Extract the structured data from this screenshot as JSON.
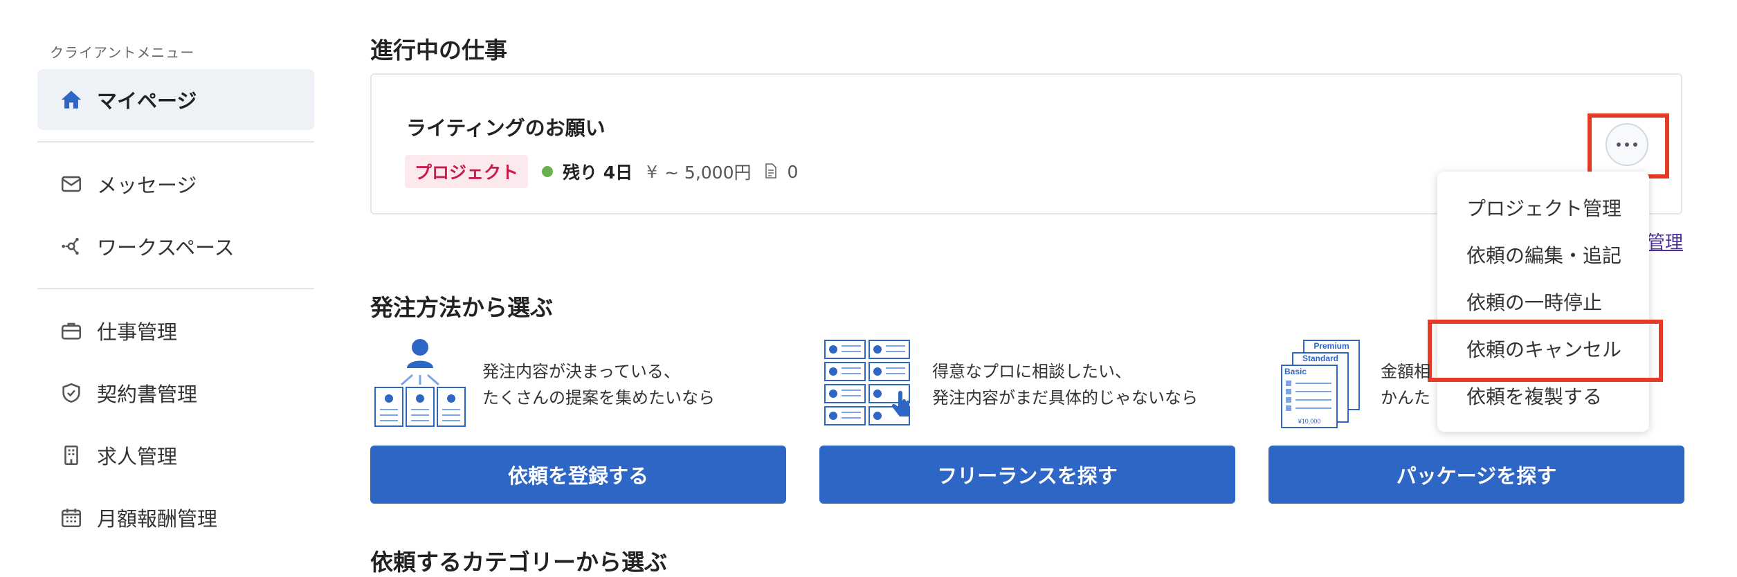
{
  "sidebar": {
    "caption": "クライアントメニュー",
    "items": [
      {
        "label": "マイページ",
        "icon": "home-icon"
      },
      {
        "label": "メッセージ",
        "icon": "mail-icon"
      },
      {
        "label": "ワークスペース",
        "icon": "network-icon"
      },
      {
        "label": "仕事管理",
        "icon": "briefcase-icon"
      },
      {
        "label": "契約書管理",
        "icon": "shield-check-icon"
      },
      {
        "label": "求人管理",
        "icon": "building-icon"
      },
      {
        "label": "月額報酬管理",
        "icon": "calendar-icon"
      }
    ]
  },
  "in_progress": {
    "section_title": "進行中の仕事",
    "job": {
      "title": "ライティングのお願い",
      "tag": "プロジェクト",
      "remaining": "残り 4日",
      "yen_symbol": "¥",
      "price": "~ 5,000円",
      "doc_count": "0"
    },
    "menu": {
      "items": [
        "プロジェクト管理",
        "依頼の編集・追記",
        "依頼の一時停止",
        "依頼のキャンセル",
        "依頼を複製する"
      ]
    },
    "manage_link": "管理"
  },
  "order_methods": {
    "section_title": "発注方法から選ぶ",
    "cards": [
      {
        "line1": "発注内容が決まっている、",
        "line2": "たくさんの提案を集めたいなら",
        "button": "依頼を登録する"
      },
      {
        "line1": "得意なプロに相談したい、",
        "line2": "発注内容がまだ具体的じゃないなら",
        "button": "フリーランスを探す"
      },
      {
        "line1": "金額相",
        "line2": "かんた",
        "button": "パッケージを探す"
      }
    ],
    "package_labels": {
      "premium": "Premium",
      "standard": "Standard",
      "basic": "Basic",
      "price": "¥10,000"
    }
  },
  "bottom_cut_title": "依頼するカテゴリーから選ぶ",
  "colors": {
    "primary": "#2e66c5",
    "highlight_red": "#e53a26",
    "tag_red": "#c81d4a"
  }
}
